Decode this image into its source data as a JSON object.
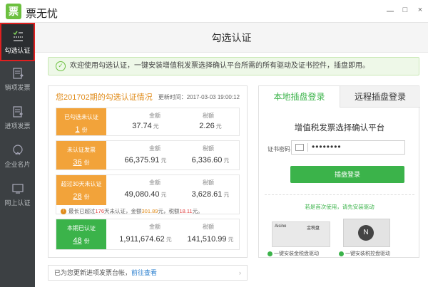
{
  "window": {
    "logo_glyph": "票",
    "title": "票无忧",
    "controls": [
      "一",
      "□",
      "×"
    ]
  },
  "sidebar": {
    "items": [
      {
        "label": "勾选认证",
        "icon": "checklist-icon",
        "active": true
      },
      {
        "label": "销项发票",
        "icon": "invoice-out-icon",
        "active": false
      },
      {
        "label": "进项发票",
        "icon": "invoice-in-icon",
        "active": false
      },
      {
        "label": "企业名片",
        "icon": "business-card-icon",
        "active": false
      },
      {
        "label": "网上认证",
        "icon": "online-cert-icon",
        "active": false
      }
    ]
  },
  "main": {
    "title": "勾选认证",
    "notice": "欢迎使用勾选认证，一键安装增值税发票选择确认平台所需的所有驱动及证书控件，插盘即用。"
  },
  "status_panel": {
    "heading": "您201702期的勾选认证情况",
    "update_time": "更新时间：2017-03-03 19:00:12",
    "amount_label": "金额",
    "tax_label": "税额",
    "yuan_unit": "元",
    "count_unit": "份",
    "rows": [
      {
        "title": "已勾选未认证",
        "count": "1",
        "amount": "37.74",
        "tax": "2.26",
        "color": "#f2a33a"
      },
      {
        "title": "未认证发票",
        "count": "36",
        "amount": "66,375.91",
        "tax": "6,336.60",
        "color": "#f2a33a"
      },
      {
        "title": "超过30天未认证",
        "count": "28",
        "amount": "49,080.40",
        "tax": "3,628.61",
        "color": "#f2a33a"
      },
      {
        "title": "本期已认证",
        "count": "48",
        "amount": "1,911,674.62",
        "tax": "141,510.99",
        "color": "#3bb34a"
      }
    ],
    "warning": {
      "prefix": "最长已超过",
      "days": "176",
      "mid": "天未认证，金额",
      "amount": "301.89",
      "mid2": "元，税额",
      "tax": "18.11",
      "suffix": "元。"
    }
  },
  "bottom_bar": {
    "text": "已为您更新进项发票台帐，",
    "link": "前往查看"
  },
  "login_panel": {
    "tab_local": "本地插盘登录",
    "tab_remote": "远程插盘登录",
    "platform_title": "增值税发票选择确认平台",
    "password_label": "证书密码",
    "password_value": "••••••••",
    "login_button": "插盘登录",
    "hint": "若是首次使用，请先安装驱动",
    "device1_brand": "Aisino",
    "device1_tag": "金税盘",
    "device2_badge": "N",
    "install1": "一键安装金税盘驱动",
    "install2": "一键安装税控盘驱动"
  },
  "colors": {
    "accent_green": "#3bb34a",
    "accent_orange": "#f2a33a",
    "sidebar_bg": "#3c4043"
  }
}
